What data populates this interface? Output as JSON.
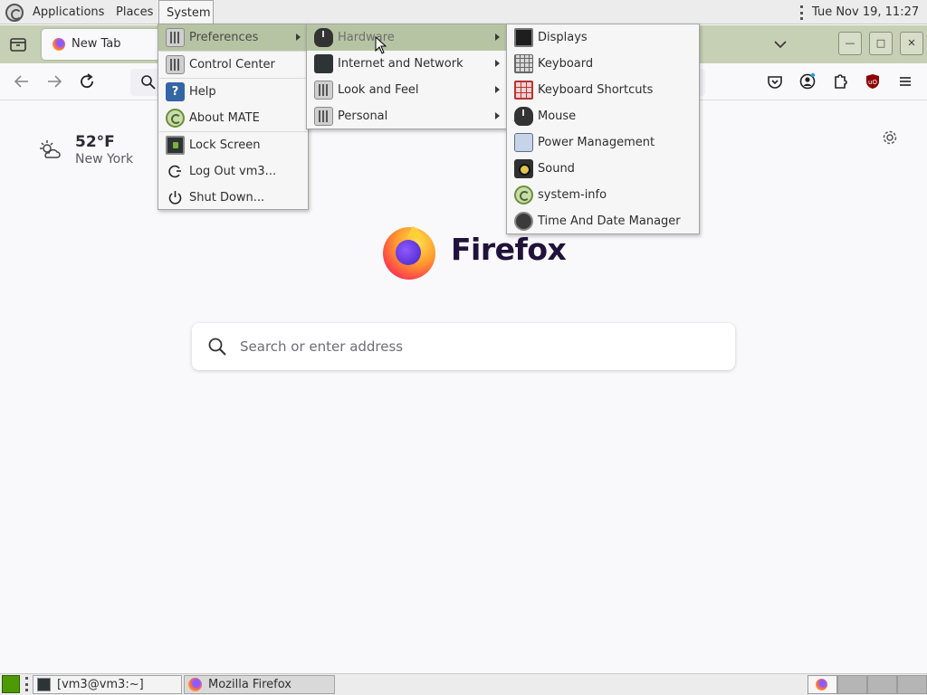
{
  "top_panel": {
    "menus": [
      "Applications",
      "Places",
      "System"
    ],
    "clock": "Tue Nov 19, 11:27 AM"
  },
  "firefox": {
    "tab_title": "New Tab",
    "weather": {
      "temp": "52°F",
      "city": "New York",
      "icon": "partly-sunny-icon"
    },
    "wordmark": "Firefox",
    "search_placeholder": "Search or enter address"
  },
  "system_menu": {
    "items": [
      {
        "label": "Preferences",
        "icon": "preferences-icon",
        "submenu": true,
        "highlighted": true
      },
      {
        "label": "Control Center",
        "icon": "control-center-icon"
      },
      {
        "label": "Help",
        "icon": "help-icon"
      },
      {
        "label": "About MATE",
        "icon": "mate-logo-icon"
      },
      {
        "label": "Lock Screen",
        "icon": "lock-screen-icon"
      },
      {
        "label": "Log Out vm3...",
        "icon": "logout-icon"
      },
      {
        "label": "Shut Down...",
        "icon": "power-icon"
      }
    ]
  },
  "preferences_menu": {
    "items": [
      {
        "label": "Hardware",
        "icon": "hardware-icon",
        "submenu": true,
        "highlighted": true
      },
      {
        "label": "Internet and Network",
        "icon": "network-icon",
        "submenu": true
      },
      {
        "label": "Look and Feel",
        "icon": "look-and-feel-icon",
        "submenu": true
      },
      {
        "label": "Personal",
        "icon": "personal-icon",
        "submenu": true
      }
    ]
  },
  "hardware_menu": {
    "items": [
      {
        "label": "Displays",
        "icon": "display-icon"
      },
      {
        "label": "Keyboard",
        "icon": "keyboard-icon"
      },
      {
        "label": "Keyboard Shortcuts",
        "icon": "keyboard-shortcuts-icon"
      },
      {
        "label": "Mouse",
        "icon": "mouse-icon"
      },
      {
        "label": "Power Management",
        "icon": "power-management-icon"
      },
      {
        "label": "Sound",
        "icon": "sound-icon"
      },
      {
        "label": "system-info",
        "icon": "system-info-icon"
      },
      {
        "label": "Time And Date Manager",
        "icon": "clock-icon"
      }
    ]
  },
  "bottom_panel": {
    "tasks": [
      "[vm3@vm3:~]",
      "Mozilla Firefox"
    ]
  },
  "colors": {
    "menu_highlight": "#b7c4a3",
    "tabbar": "#c6d0b4"
  }
}
